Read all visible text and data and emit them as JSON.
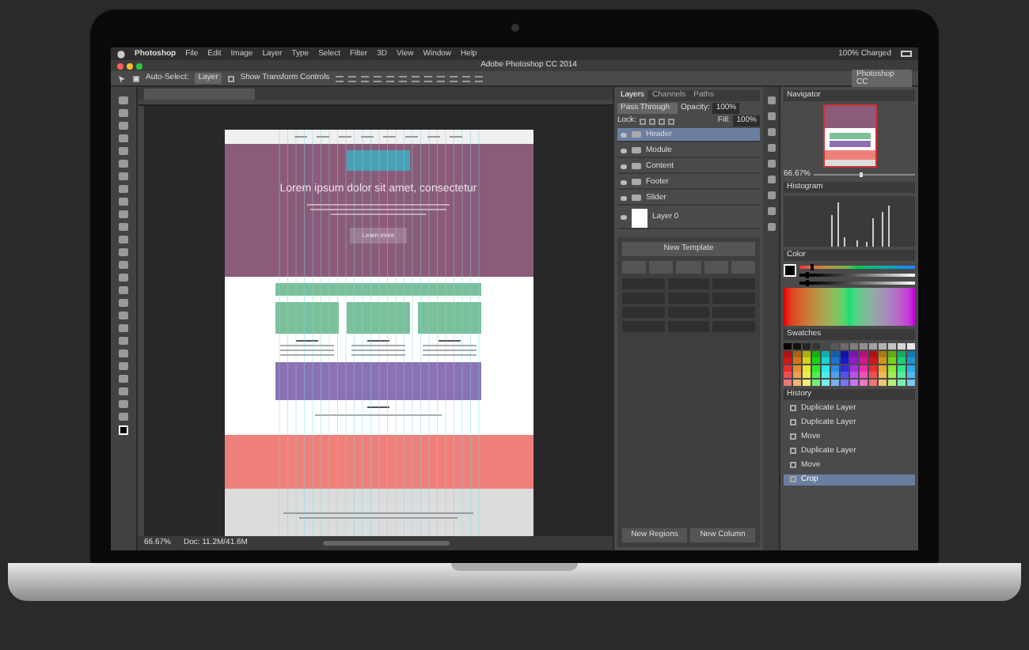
{
  "menu_bar": {
    "items": [
      "Photoshop",
      "File",
      "Edit",
      "Image",
      "Layer",
      "Type",
      "Select",
      "Filter",
      "3D",
      "View",
      "Window",
      "Help"
    ],
    "battery": "100% Charged"
  },
  "window": {
    "title": "Adobe Photoshop CC 2014"
  },
  "options_bar": {
    "auto_select_checked": true,
    "transform_checked": false,
    "auto_select": "Auto-Select:",
    "target": "Layer",
    "show_transform": "Show Transform Controls",
    "workspace": "Photoshop CC"
  },
  "canvas": {
    "headline": "Lorem ipsum dolor sit amet, consectetur",
    "button": "Learn more"
  },
  "status_bar": {
    "zoom": "66.67%",
    "doc": "Doc: 11.2M/41.6M"
  },
  "layers_panel": {
    "tabs": [
      {
        "label": "Layers",
        "selected": true
      },
      {
        "label": "Channels",
        "selected": false
      },
      {
        "label": "Paths",
        "selected": false
      }
    ],
    "blend_mode": "Pass Through",
    "opacity_label": "Opacity:",
    "opacity": "100%",
    "lock_label": "Lock:",
    "fill_label": "Fill:",
    "fill": "100%",
    "layers": [
      {
        "name": "Header",
        "kind": "folder",
        "selected": true
      },
      {
        "name": "Module",
        "kind": "folder",
        "selected": false
      },
      {
        "name": "Content",
        "kind": "folder",
        "selected": false
      },
      {
        "name": "Footer",
        "kind": "folder",
        "selected": false
      },
      {
        "name": "Slider",
        "kind": "folder",
        "selected": false
      },
      {
        "name": "Layer 0",
        "kind": "image",
        "selected": false
      }
    ]
  },
  "template_panel": {
    "new_template": "New Template",
    "buttons": [
      "New Regions",
      "New Column"
    ]
  },
  "navigator": {
    "title": "Navigator",
    "zoom": "66.67%",
    "level": 0.45
  },
  "histogram": {
    "title": "Histogram"
  },
  "color": {
    "title": "Color",
    "sliders": [
      {
        "kind": "hue",
        "level": 0.1
      },
      {
        "kind": "saturation",
        "level": 0.05
      },
      {
        "kind": "brightness",
        "level": 0.05
      }
    ]
  },
  "swatches": {
    "title": "Swatches"
  },
  "history": {
    "title": "History",
    "items": [
      {
        "label": "Duplicate Layer",
        "selected": false
      },
      {
        "label": "Duplicate Layer",
        "selected": false
      },
      {
        "label": "Move",
        "selected": false
      },
      {
        "label": "Duplicate Layer",
        "selected": false
      },
      {
        "label": "Move",
        "selected": false
      },
      {
        "label": "Crop",
        "selected": true
      }
    ]
  }
}
